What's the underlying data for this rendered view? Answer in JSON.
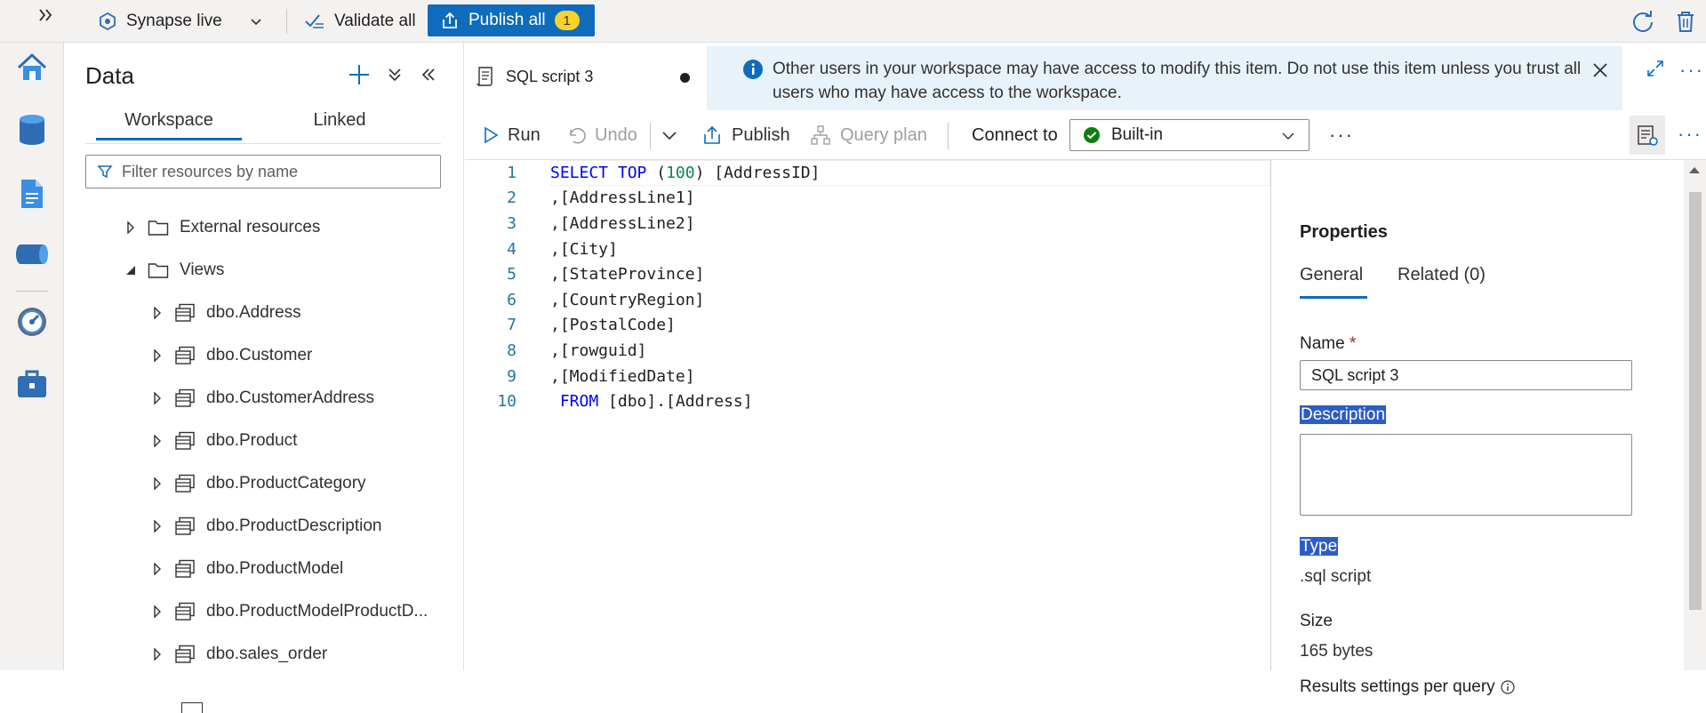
{
  "topbar": {
    "workspace_label": "Synapse live",
    "validate_label": "Validate all",
    "publish_all_label": "Publish all",
    "publish_count": "1"
  },
  "rail": {
    "items": [
      "home-icon",
      "data-icon",
      "develop-icon",
      "integrate-icon",
      "monitor-icon",
      "manage-icon"
    ]
  },
  "data_panel": {
    "title": "Data",
    "tabs": [
      "Workspace",
      "Linked"
    ],
    "filter_placeholder": "Filter resources by name",
    "tree": [
      {
        "label": "External resources",
        "type": "folder",
        "expanded": false
      },
      {
        "label": "Views",
        "type": "folder",
        "expanded": true
      },
      {
        "label": "dbo.Address",
        "type": "view"
      },
      {
        "label": "dbo.Customer",
        "type": "view"
      },
      {
        "label": "dbo.CustomerAddress",
        "type": "view"
      },
      {
        "label": "dbo.Product",
        "type": "view"
      },
      {
        "label": "dbo.ProductCategory",
        "type": "view"
      },
      {
        "label": "dbo.ProductDescription",
        "type": "view"
      },
      {
        "label": "dbo.ProductModel",
        "type": "view"
      },
      {
        "label": "dbo.ProductModelProductD...",
        "type": "view"
      },
      {
        "label": "dbo.sales_order",
        "type": "view"
      }
    ]
  },
  "editor": {
    "tab_title": "SQL script 3",
    "info_message": "Other users in your workspace may have access to modify this item. Do not use this item unless you trust all users who may have access to the workspace.",
    "toolbar": {
      "run": "Run",
      "undo": "Undo",
      "publish": "Publish",
      "query_plan": "Query plan",
      "connect_to": "Connect to",
      "connection": "Built-in"
    },
    "code_lines": [
      {
        "n": "1",
        "text": "SELECT TOP (100) [AddressID]"
      },
      {
        "n": "2",
        "text": ",[AddressLine1]"
      },
      {
        "n": "3",
        "text": ",[AddressLine2]"
      },
      {
        "n": "4",
        "text": ",[City]"
      },
      {
        "n": "5",
        "text": ",[StateProvince]"
      },
      {
        "n": "6",
        "text": ",[CountryRegion]"
      },
      {
        "n": "7",
        "text": ",[PostalCode]"
      },
      {
        "n": "8",
        "text": ",[rowguid]"
      },
      {
        "n": "9",
        "text": ",[ModifiedDate]"
      },
      {
        "n": "10",
        "text": " FROM [dbo].[Address]"
      }
    ]
  },
  "properties": {
    "title": "Properties",
    "tabs": {
      "general": "General",
      "related": "Related (0)"
    },
    "name_label": "Name",
    "required_mark": "*",
    "name_value": "SQL script 3",
    "description_label": "Description",
    "type_label": "Type",
    "type_value": ".sql script",
    "size_label": "Size",
    "size_value": "165 bytes",
    "results_label": "Results settings per query"
  },
  "colors": {
    "accent": "#0f6cbd",
    "badge": "#f8d22a",
    "info_bg": "#e8f2fb"
  }
}
